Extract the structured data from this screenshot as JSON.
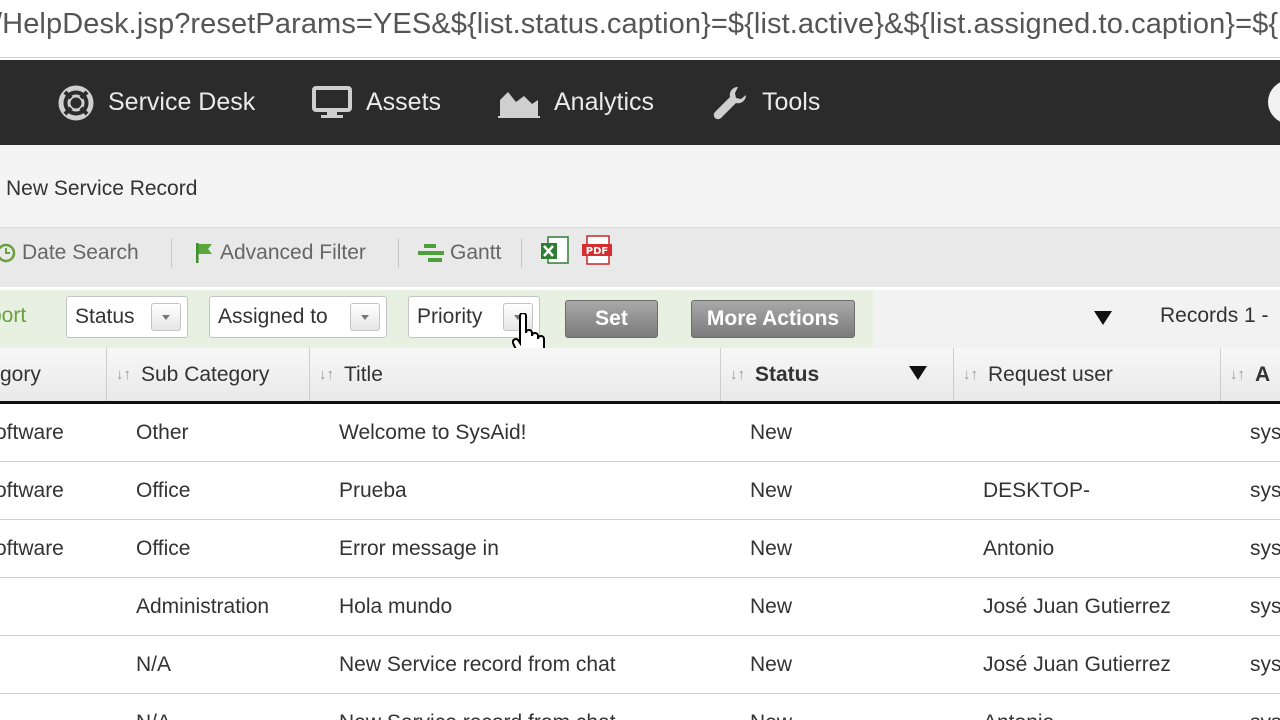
{
  "browser": {
    "url": "/HelpDesk.jsp?resetParams=YES&${list.status.caption}=${list.active}&${list.assigned.to.caption}=${"
  },
  "nav": {
    "items": [
      {
        "label": "Service Desk",
        "icon": "lifebuoy-icon"
      },
      {
        "label": "Assets",
        "icon": "monitor-icon"
      },
      {
        "label": "Analytics",
        "icon": "area-chart-icon"
      },
      {
        "label": "Tools",
        "icon": "wrench-icon"
      }
    ]
  },
  "page": {
    "title": "New Service Record"
  },
  "toolbar": {
    "date_search": "Date Search",
    "advanced_filter": "Advanced Filter",
    "gantt": "Gantt"
  },
  "filters": {
    "report_label": "port",
    "status": "Status",
    "assigned_to": "Assigned to",
    "priority": "Priority",
    "set_button": "Set",
    "more_actions": "More Actions",
    "records": "Records 1 -"
  },
  "table": {
    "headers": [
      "gory",
      "Sub Category",
      "Title",
      "Status",
      "Request user",
      "A"
    ],
    "rows": [
      {
        "category": "oftware",
        "sub_category": "Other",
        "title": "Welcome to SysAid!",
        "status": "New",
        "request_user": "",
        "assigned": "sys"
      },
      {
        "category": "oftware",
        "sub_category": "Office",
        "title": "Prueba",
        "status": "New",
        "request_user": "DESKTOP-",
        "assigned": "sys"
      },
      {
        "category": "oftware",
        "sub_category": "Office",
        "title": "Error message in",
        "status": "New",
        "request_user": "Antonio",
        "assigned": "sys"
      },
      {
        "category": "",
        "sub_category": "Administration",
        "title": "Hola mundo",
        "status": "New",
        "request_user": "José Juan Gutierrez",
        "assigned": "sys"
      },
      {
        "category": "",
        "sub_category": "N/A",
        "title": "New Service record from chat",
        "status": "New",
        "request_user": "José Juan Gutierrez",
        "assigned": "sys"
      },
      {
        "category": "",
        "sub_category": "N/A",
        "title": "New Service record from chat",
        "status": "New",
        "request_user": "Antonio",
        "assigned": "sys"
      }
    ]
  },
  "colors": {
    "nav_bg": "#2b2b2b",
    "accent_green": "#6aa03e",
    "button_gray": "#8f8f8f"
  }
}
